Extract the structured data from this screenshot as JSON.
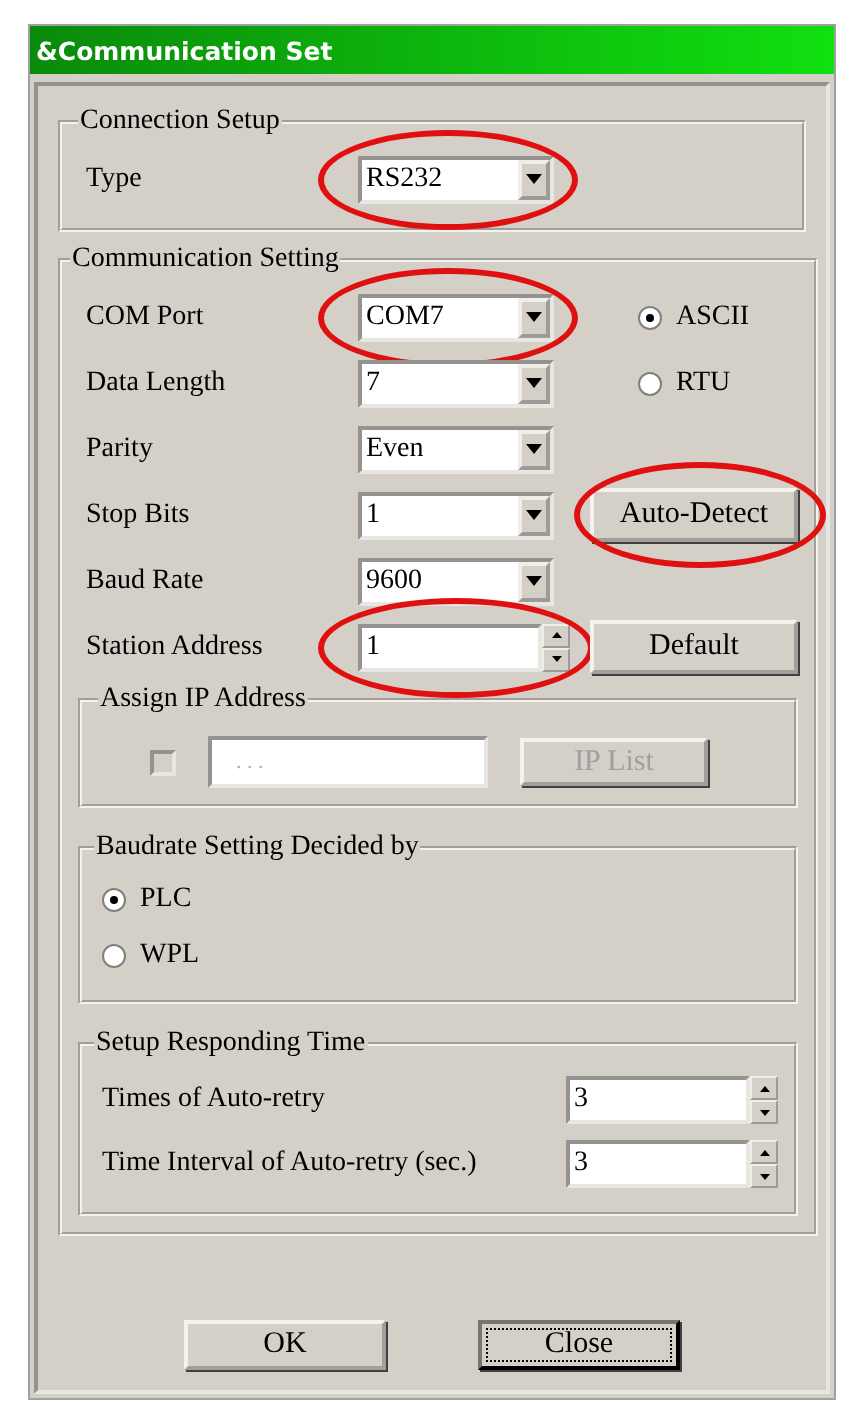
{
  "window": {
    "title": "&Communication Set"
  },
  "connection_setup": {
    "title": "Connection Setup",
    "fields": [
      {
        "label": "Type",
        "kind": "combo",
        "value": "RS232",
        "highlighted": true
      }
    ]
  },
  "communication_setting": {
    "title": "Communication Setting",
    "fields": [
      {
        "label": "COM Port",
        "kind": "combo",
        "value": "COM7",
        "highlighted": true
      },
      {
        "label": "Data Length",
        "kind": "combo",
        "value": "7",
        "highlighted": false
      },
      {
        "label": "Parity",
        "kind": "combo",
        "value": "Even",
        "highlighted": false
      },
      {
        "label": "Stop Bits",
        "kind": "combo",
        "value": "1",
        "highlighted": false
      },
      {
        "label": "Baud Rate",
        "kind": "combo",
        "value": "9600",
        "highlighted": false
      },
      {
        "label": "Station Address",
        "kind": "spin",
        "value": "1",
        "highlighted": true
      }
    ],
    "modes": [
      {
        "label": "ASCII",
        "selected": true
      },
      {
        "label": "RTU",
        "selected": false
      }
    ],
    "buttons": [
      {
        "label": "Auto-Detect",
        "highlighted": true
      },
      {
        "label": "Default",
        "highlighted": false
      }
    ],
    "assign_ip": {
      "title": "Assign IP Address",
      "checked": false,
      "disabled": true,
      "ip_value": ". . .",
      "button": "IP List"
    },
    "baudrate_setting": {
      "title": "Baudrate Setting Decided by",
      "options": [
        {
          "label": "PLC",
          "selected": true
        },
        {
          "label": "WPL",
          "selected": false
        }
      ]
    },
    "responding_time": {
      "title": "Setup Responding Time",
      "fields": [
        {
          "label": "Times of Auto-retry",
          "kind": "spin",
          "value": "3",
          "highlighted": false
        },
        {
          "label": "Time Interval of Auto-retry (sec.)",
          "kind": "spin",
          "value": "3",
          "highlighted": false
        }
      ]
    }
  },
  "buttons": [
    {
      "label": "OK",
      "focused": false
    },
    {
      "label": "Close",
      "focused": true
    }
  ]
}
